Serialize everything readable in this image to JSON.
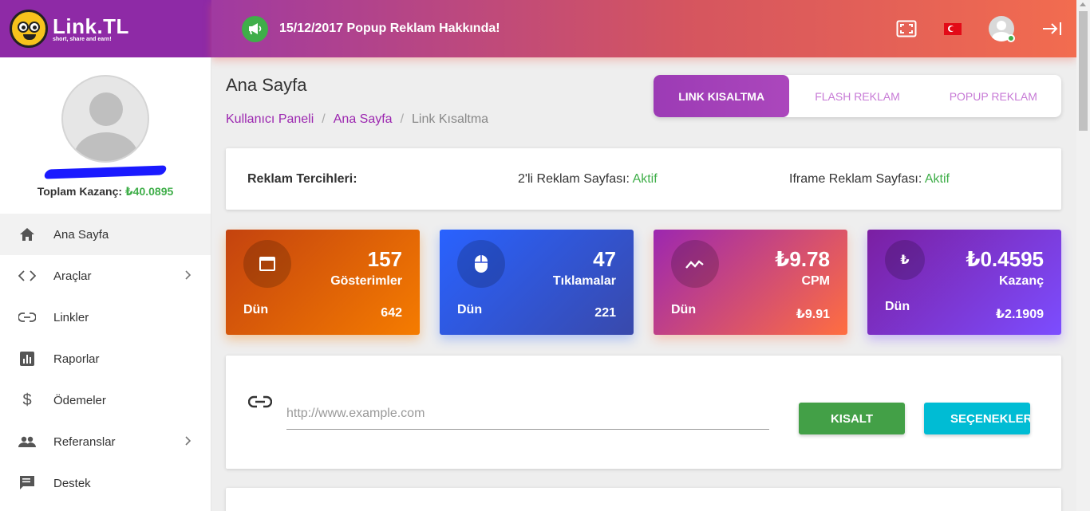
{
  "brand": {
    "name": "Link.TL",
    "tagline": "short, share and earn!"
  },
  "topbar": {
    "announcement": "15/12/2017 Popup Reklam Hakkında!",
    "icons": [
      "megaphone-icon",
      "fullscreen-icon",
      "turkey-flag-icon",
      "user-avatar",
      "logout-icon"
    ]
  },
  "sidebar": {
    "earnings_label": "Toplam Kazanç:",
    "earnings_value": "₺40.0895",
    "items": [
      {
        "label": "Ana Sayfa",
        "icon": "home-icon",
        "active": true
      },
      {
        "label": "Araçlar",
        "icon": "code-icon",
        "has_children": true
      },
      {
        "label": "Linkler",
        "icon": "link-icon"
      },
      {
        "label": "Raporlar",
        "icon": "bar-chart-icon"
      },
      {
        "label": "Ödemeler",
        "icon": "dollar-icon"
      },
      {
        "label": "Referanslar",
        "icon": "people-icon",
        "has_children": true
      },
      {
        "label": "Destek",
        "icon": "chat-icon"
      }
    ]
  },
  "page": {
    "title": "Ana Sayfa",
    "breadcrumb": [
      "Kullanıcı Paneli",
      "Ana Sayfa",
      "Link Kısaltma"
    ]
  },
  "tabs": [
    {
      "label": "LINK KISALTMA",
      "active": true
    },
    {
      "label": "FLASH REKLAM",
      "active": false
    },
    {
      "label": "POPUP REKLAM",
      "active": false
    }
  ],
  "prefs": {
    "title": "Reklam Tercihleri:",
    "item1_label": "2'li Reklam Sayfası:",
    "item1_value": "Aktif",
    "item2_label": "Iframe Reklam Sayfası:",
    "item2_value": "Aktif"
  },
  "stats": [
    {
      "value": "157",
      "label": "Gösterimler",
      "period": "Dün",
      "prev": "642",
      "icon": "window-icon"
    },
    {
      "value": "47",
      "label": "Tıklamalar",
      "period": "Dün",
      "prev": "221",
      "icon": "mouse-icon"
    },
    {
      "value": "₺9.78",
      "label": "CPM",
      "period": "Dün",
      "prev": "₺9.91",
      "icon": "trend-icon"
    },
    {
      "value": "₺0.4595",
      "label": "Kazanç",
      "period": "Dün",
      "prev": "₺2.1909",
      "icon": "lira-icon"
    }
  ],
  "shorten": {
    "placeholder": "http://www.example.com",
    "value": "",
    "shorten_label": "KISALT",
    "options_label": "SEÇENEKLER"
  },
  "colors": {
    "brand_purple": "#8e2aa6",
    "accent_green": "#3fae49",
    "options_cyan": "#00bcd4"
  }
}
